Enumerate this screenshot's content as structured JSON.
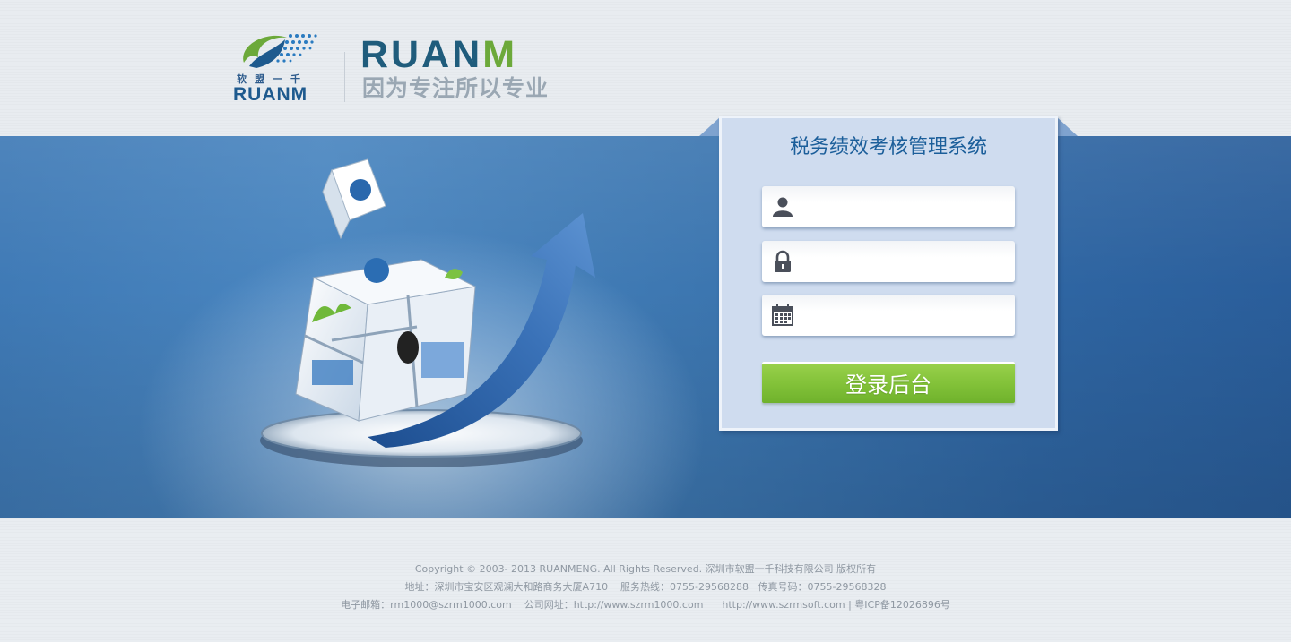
{
  "logo": {
    "small_cn": "软盟一千",
    "small_en": "RUANM",
    "big_en_part1": "RUAN",
    "big_en_part2": "M",
    "slogan": "因为专注所以专业",
    "colors": {
      "blue": "#1f5c7c",
      "green": "#6ca93a",
      "gray": "#9aa7b3"
    }
  },
  "login": {
    "title": "税务绩效考核管理系统",
    "fields": [
      {
        "icon": "user-icon",
        "value": "",
        "placeholder": ""
      },
      {
        "icon": "lock-icon",
        "value": "",
        "placeholder": ""
      },
      {
        "icon": "calendar-icon",
        "value": "",
        "placeholder": ""
      }
    ],
    "submit_label": "登录后台",
    "button_color": "#84c33a"
  },
  "footer": {
    "line1": "Copyright © 2003- 2013 RUANMENG. All Rights Reserved. 深圳市软盟一千科技有限公司 版权所有",
    "line2": "地址：深圳市宝安区观澜大和路商务大厦A710    服务热线：0755-29568288   传真号码：0755-29568328",
    "line3": "电子邮箱：rm1000@szrm1000.com    公司网址：http://www.szrm1000.com      http://www.szrmsoft.com | 粤ICP备12026896号"
  }
}
